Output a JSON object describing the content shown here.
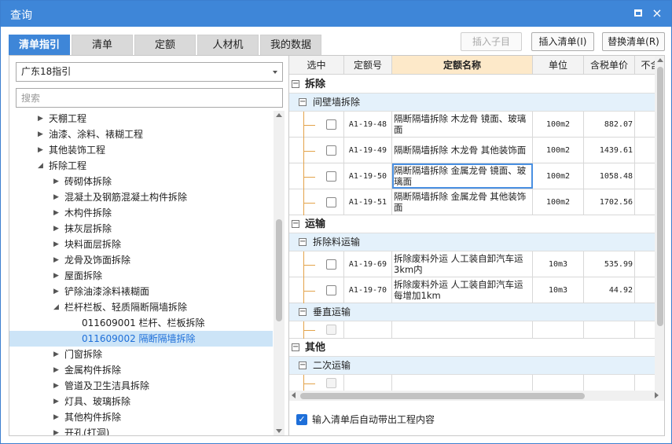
{
  "window": {
    "title": "查询",
    "maximize_icon": "maximize-icon",
    "close_icon": "close-icon",
    "close_glyph": "×"
  },
  "tabs": [
    {
      "label": "清单指引",
      "active": true
    },
    {
      "label": "清单",
      "active": false
    },
    {
      "label": "定额",
      "active": false
    },
    {
      "label": "人材机",
      "active": false
    },
    {
      "label": "我的数据",
      "active": false
    }
  ],
  "buttons": {
    "insert_child": "插入子目",
    "insert_list": "插入清单(I)",
    "replace_list": "替换清单(R)"
  },
  "left": {
    "dropdown_value": "广东18指引",
    "search_placeholder": "搜索",
    "tree": [
      {
        "label": "天棚工程",
        "level": 0,
        "arrow": "▶"
      },
      {
        "label": "油漆、涂料、裱糊工程",
        "level": 0,
        "arrow": "▶"
      },
      {
        "label": "其他装饰工程",
        "level": 0,
        "arrow": "▶"
      },
      {
        "label": "拆除工程",
        "level": 0,
        "arrow": "◢"
      },
      {
        "label": "砖砌体拆除",
        "level": 1,
        "arrow": "▶"
      },
      {
        "label": "混凝土及钢筋混凝土构件拆除",
        "level": 1,
        "arrow": "▶"
      },
      {
        "label": "木构件拆除",
        "level": 1,
        "arrow": "▶"
      },
      {
        "label": "抹灰层拆除",
        "level": 1,
        "arrow": "▶"
      },
      {
        "label": "块料面层拆除",
        "level": 1,
        "arrow": "▶"
      },
      {
        "label": "龙骨及饰面拆除",
        "level": 1,
        "arrow": "▶"
      },
      {
        "label": "屋面拆除",
        "level": 1,
        "arrow": "▶"
      },
      {
        "label": "铲除油漆涂料裱糊面",
        "level": 1,
        "arrow": "▶"
      },
      {
        "label": "栏杆栏板、轻质隔断隔墙拆除",
        "level": 1,
        "arrow": "◢"
      },
      {
        "label": "011609001  栏杆、栏板拆除",
        "level": 2,
        "arrow": ""
      },
      {
        "label": "011609002  隔断隔墙拆除",
        "level": 2,
        "arrow": "",
        "selected": true
      },
      {
        "label": "门窗拆除",
        "level": 1,
        "arrow": "▶"
      },
      {
        "label": "金属构件拆除",
        "level": 1,
        "arrow": "▶"
      },
      {
        "label": "管道及卫生洁具拆除",
        "level": 1,
        "arrow": "▶"
      },
      {
        "label": "灯具、玻璃拆除",
        "level": 1,
        "arrow": "▶"
      },
      {
        "label": "其他构件拆除",
        "level": 1,
        "arrow": "▶"
      },
      {
        "label": "开孔(打洞)",
        "level": 1,
        "arrow": "▶"
      }
    ]
  },
  "grid": {
    "headers": [
      "选中",
      "定额号",
      "定额名称",
      "单位",
      "含税单价",
      "不含"
    ],
    "rows": [
      {
        "kind": "section",
        "text": "拆除",
        "toggle": "−"
      },
      {
        "kind": "sub",
        "text": "间壁墙拆除",
        "toggle": "−"
      },
      {
        "kind": "data",
        "code": "A1-19-48",
        "name": "隔断隔墙拆除 木龙骨 镜面、玻璃面",
        "unit": "100m2",
        "price": "882.07"
      },
      {
        "kind": "data",
        "code": "A1-19-49",
        "name": "隔断隔墙拆除 木龙骨 其他装饰面",
        "unit": "100m2",
        "price": "1439.61"
      },
      {
        "kind": "data",
        "code": "A1-19-50",
        "name": "隔断隔墙拆除 金属龙骨 镜面、玻璃面",
        "unit": "100m2",
        "price": "1058.48",
        "focus": true
      },
      {
        "kind": "data",
        "code": "A1-19-51",
        "name": "隔断隔墙拆除 金属龙骨 其他装饰面",
        "unit": "100m2",
        "price": "1702.56"
      },
      {
        "kind": "section",
        "text": "运输",
        "toggle": "−"
      },
      {
        "kind": "sub",
        "text": "拆除料运输",
        "toggle": "−"
      },
      {
        "kind": "data",
        "code": "A1-19-69",
        "name": "拆除废料外运 人工装自卸汽车运3km内",
        "unit": "10m3",
        "price": "535.99"
      },
      {
        "kind": "data",
        "code": "A1-19-70",
        "name": "拆除废料外运 人工装自卸汽车运每增加1km",
        "unit": "10m3",
        "price": "44.92"
      },
      {
        "kind": "sub",
        "text": "垂直运输",
        "toggle": "−"
      },
      {
        "kind": "empty"
      },
      {
        "kind": "section",
        "text": "其他",
        "toggle": "−"
      },
      {
        "kind": "sub",
        "text": "二次运输",
        "toggle": "−"
      },
      {
        "kind": "empty"
      }
    ]
  },
  "footer": {
    "auto_bring": "输入清单后自动带出工程内容",
    "checked": true,
    "check_glyph": "✓"
  }
}
